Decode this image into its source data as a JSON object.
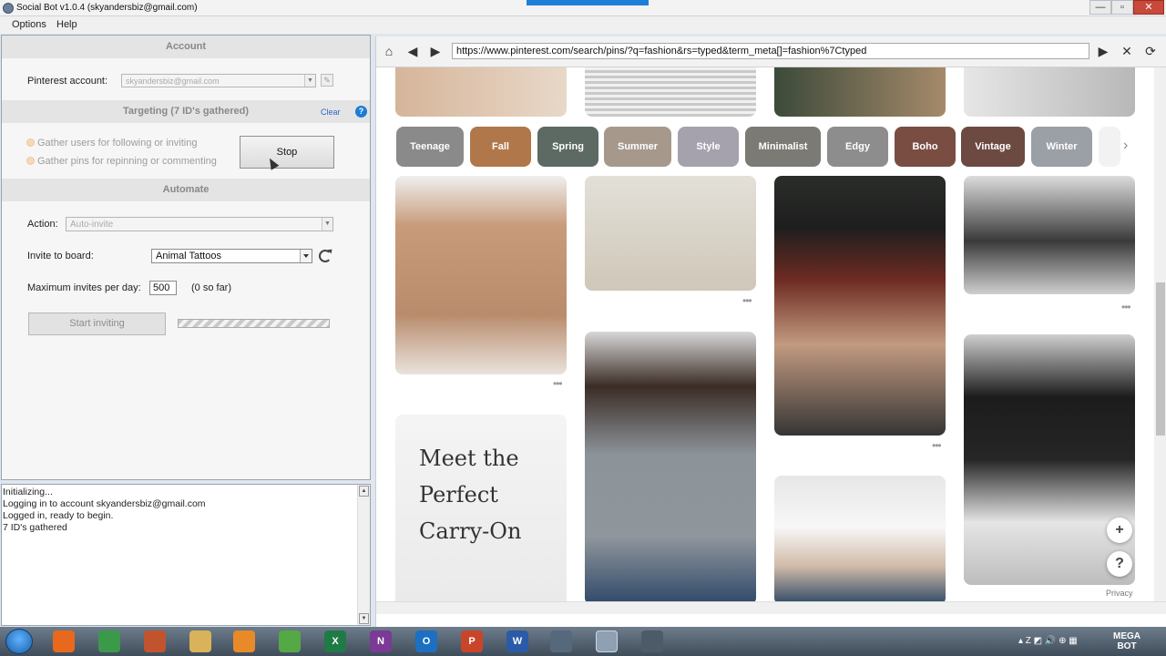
{
  "window": {
    "title": "Social Bot v1.0.4 (skyandersbiz@gmail.com)",
    "controls": {
      "minimize": "—",
      "maximize": "▫",
      "close": "✕"
    }
  },
  "menu": [
    "Options",
    "Help"
  ],
  "account": {
    "header": "Account",
    "label": "Pinterest account:",
    "value": "skyandersbiz@gmail.com"
  },
  "targeting": {
    "header": "Targeting (7 ID's gathered)",
    "clear": "Clear",
    "help": "?",
    "option1": "Gather users for following or inviting",
    "option2": "Gather pins for repinning or commenting",
    "stop": "Stop"
  },
  "automate": {
    "header": "Automate",
    "action_label": "Action:",
    "action_value": "Auto-invite",
    "board_label": "Invite to board:",
    "board_value": "Animal Tattoos",
    "max_label": "Maximum invites per day:",
    "max_value": "500",
    "max_note": "(0 so far)",
    "start": "Start inviting"
  },
  "log": [
    "Initializing...",
    "Logging in to account skyandersbiz@gmail.com",
    "Logged in, ready to begin.",
    "7 ID's gathered"
  ],
  "browser": {
    "url": "https://www.pinterest.com/search/pins/?q=fashion&rs=typed&term_meta[]=fashion%7Ctyped",
    "chips": [
      {
        "label": "Teenage",
        "color": "#8a8a8a"
      },
      {
        "label": "Fall",
        "color": "#b0784a"
      },
      {
        "label": "Spring",
        "color": "#5c6a63"
      },
      {
        "label": "Summer",
        "color": "#a6998c"
      },
      {
        "label": "Style",
        "color": "#a5a2ad"
      },
      {
        "label": "Minimalist",
        "color": "#7c7a74"
      },
      {
        "label": "Edgy",
        "color": "#8d8d8d"
      },
      {
        "label": "Boho",
        "color": "#7a4d43"
      },
      {
        "label": "Vintage",
        "color": "#6c4a42"
      },
      {
        "label": "Winter",
        "color": "#9ba0a6"
      }
    ],
    "ad_text": [
      "Meet the",
      "Perfect",
      "Carry-On"
    ],
    "plus": "+",
    "help": "?",
    "privacy": "Privacy"
  },
  "taskbar": {
    "apps": [
      {
        "name": "firefox-icon",
        "label": "",
        "color": "#e8681e"
      },
      {
        "name": "chrome-icon",
        "label": "",
        "color": "#3a9a4a"
      },
      {
        "name": "app-icon",
        "label": "",
        "color": "#c2532f"
      },
      {
        "name": "folder-icon",
        "label": "",
        "color": "#d9b25a"
      },
      {
        "name": "media-player-icon",
        "label": "",
        "color": "#e88a2a"
      },
      {
        "name": "green-app-icon",
        "label": "",
        "color": "#55a846"
      },
      {
        "name": "excel-icon",
        "label": "X",
        "color": "#1f7a45"
      },
      {
        "name": "onenote-icon",
        "label": "N",
        "color": "#7a3a95"
      },
      {
        "name": "outlook-icon",
        "label": "O",
        "color": "#1c6fc1"
      },
      {
        "name": "powerpoint-icon",
        "label": "P",
        "color": "#c9452a"
      },
      {
        "name": "word-icon",
        "label": "W",
        "color": "#2b5ba8"
      },
      {
        "name": "social-bot-icon",
        "label": "",
        "color": "#55687c"
      },
      {
        "name": "user-icon",
        "label": "",
        "color": "#8fa0b3"
      },
      {
        "name": "snipping-tool-icon",
        "label": "",
        "color": "#4d5a67"
      }
    ],
    "tray": "▴ Z ◩ 🔊 ⊕ ▦",
    "megabot": [
      "MEGA",
      "BOT"
    ]
  }
}
